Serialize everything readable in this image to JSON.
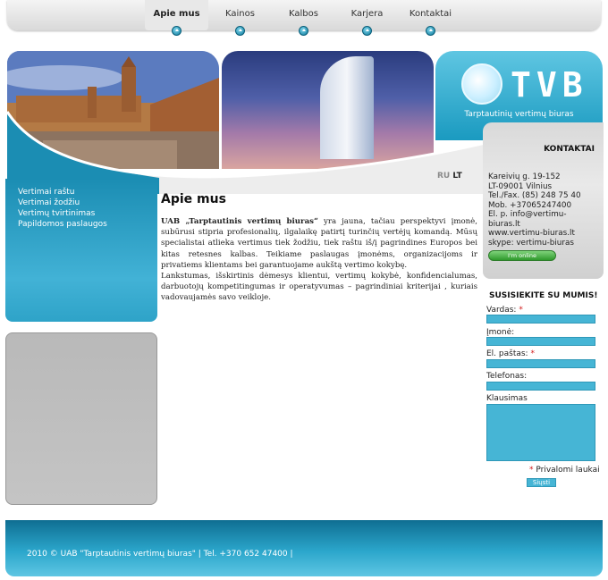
{
  "nav": {
    "items": [
      {
        "label": "Apie mus",
        "active": true
      },
      {
        "label": "Kainos",
        "active": false
      },
      {
        "label": "Kalbos",
        "active": false
      },
      {
        "label": "Karjera",
        "active": false
      },
      {
        "label": "Kontaktai",
        "active": false
      }
    ]
  },
  "logo": {
    "text": "TVB",
    "subtitle": "Tarptautinių vertimų biuras"
  },
  "left_menu": {
    "items": [
      "Vertimai raštu",
      "Vertimai žodžiu",
      "Vertimų tvirtinimas",
      "Papildomos paslaugos"
    ]
  },
  "language": {
    "ru": "RU",
    "lt": "LT"
  },
  "main": {
    "title": "Apie mus",
    "company_name": "UAB „Tarptautinis vertimų biuras“",
    "paragraph1": " yra jauna, tačiau perspektyvi įmonė, subūrusi stipria profesionalių, ilgalaikę patirtį turinčių vertėjų komandą. Mūsų specialistai atlieka vertimus tiek žodžiu, tiek raštu iš/į pagrindines Europos bei kitas retesnes kalbas. Teikiame paslaugas įmonėms, organizacijoms ir privatiems klientams bei garantuojame aukštą vertimo kokybę.",
    "paragraph2": "Lankstumas, išskirtinis dėmesys klientui, vertimų kokybė, konfidencialumas, darbuotojų kompetitingumas ir operatyvumas – pagrindiniai kriterijai , kuriais vadovaujamės savo veikloje."
  },
  "contacts": {
    "title": "KONTAKTAI",
    "lines": [
      "Kareivių g. 19-152",
      "LT-09001 Vilnius",
      "Tel./Fax. (85) 248 75 40",
      "Mob. +37065247400",
      "El. p. info@vertimu-",
      "biuras.lt",
      "www.vertimu-biuras.lt",
      "skype: vertimu-biuras"
    ],
    "online_badge": "I'm online"
  },
  "form": {
    "title": "SUSISIEKITE SU MUMIS!",
    "fields": {
      "name": {
        "label": "Vardas:",
        "required": "*"
      },
      "company": {
        "label": "Įmonė:"
      },
      "email": {
        "label": "El. paštas:",
        "required": "*"
      },
      "phone": {
        "label": "Telefonas:"
      },
      "question": {
        "label": "Klausimas"
      }
    },
    "required_note_star": "*",
    "required_note": " Privalomi laukai",
    "submit_label": "Siųsti"
  },
  "footer": {
    "text": "2010 © UAB \"Tarptautinis vertimų biuras\" | Tel. +370 652 47400 |"
  },
  "colors": {
    "accent": "#46b5d5",
    "footer_dark": "#0f6e92",
    "required": "#d21a1a"
  }
}
